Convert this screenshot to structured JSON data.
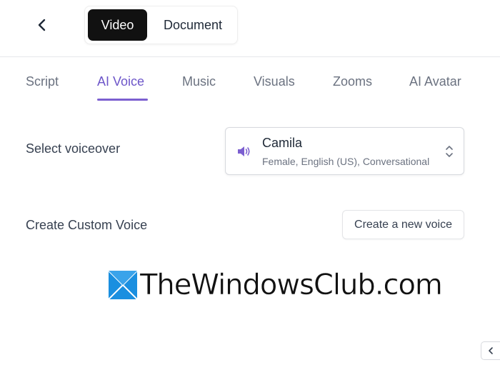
{
  "header": {
    "back_icon": "chevron-left-icon",
    "modes": [
      {
        "label": "Video",
        "active": true
      },
      {
        "label": "Document",
        "active": false
      }
    ]
  },
  "tabs": [
    {
      "label": "Script",
      "active": false
    },
    {
      "label": "AI Voice",
      "active": true
    },
    {
      "label": "Music",
      "active": false
    },
    {
      "label": "Visuals",
      "active": false
    },
    {
      "label": "Zooms",
      "active": false
    },
    {
      "label": "AI Avatar",
      "active": false
    }
  ],
  "voiceover": {
    "label": "Select voiceover",
    "selected_name": "Camila",
    "selected_desc": "Female, English (US), Conversational",
    "icon": "speaker-icon"
  },
  "custom_voice": {
    "label": "Create Custom Voice",
    "button_label": "Create a new voice"
  },
  "watermark": {
    "text": "TheWindowsClub.com"
  },
  "colors": {
    "accent": "#7c5fd0",
    "active_tab_text": "#6d56c9",
    "toggle_active_bg": "#111111",
    "watermark_blue": "#1a8fe0"
  }
}
